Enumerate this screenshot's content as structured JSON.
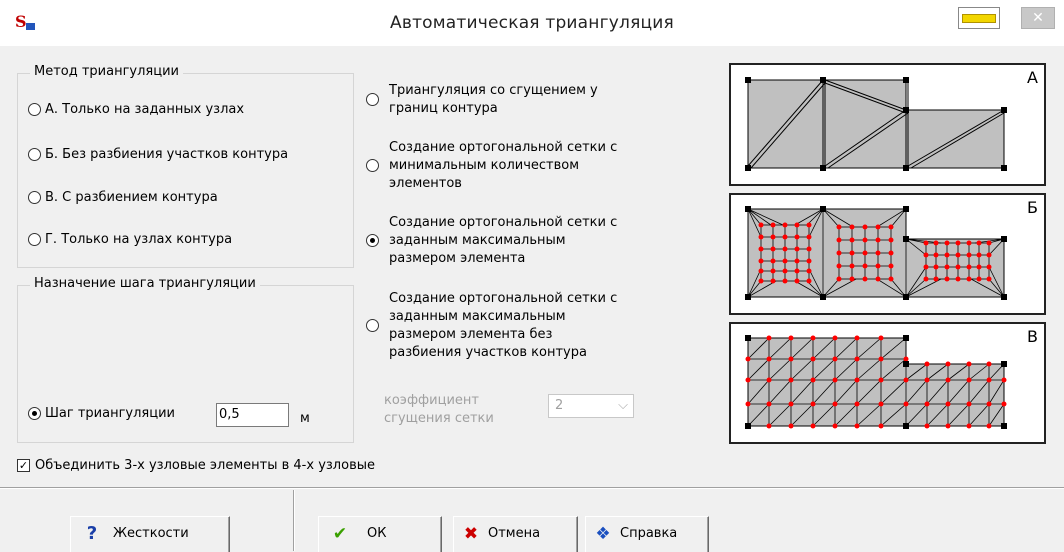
{
  "window": {
    "title": "Автоматическая триангуляция"
  },
  "method_group": {
    "title": "Метод триангуляции",
    "options": [
      {
        "label": "А. Только на заданных узлах",
        "selected": false
      },
      {
        "label": "Б. Без разбиения участков контура",
        "selected": false
      },
      {
        "label": "В. С разбиением контура",
        "selected": false
      },
      {
        "label": "Г. Только на узлах контура",
        "selected": false
      }
    ]
  },
  "sub_options": [
    {
      "label": "Триангуляция со сгущением у\nграниц контура",
      "selected": false
    },
    {
      "label": "Создание ортогональной сетки с\nминимальным количеством\nэлементов",
      "selected": false
    },
    {
      "label": "Создание ортогональной сетки с\nзаданным максимальным\nразмером элемента",
      "selected": true
    },
    {
      "label": "Создание ортогональной сетки с\nзаданным максимальным\nразмером элемента без\nразбиения участков контура",
      "selected": false
    }
  ],
  "step_group": {
    "title": "Назначение шага триангуляции",
    "step_label": "Шаг триангуляции",
    "step_value": "0,5",
    "unit": "м"
  },
  "density": {
    "label": "коэффициент\nсгущения сетки",
    "value": "2",
    "enabled": false
  },
  "merge_checkbox": {
    "label": "Объединить 3-х узловые элементы в 4-х узловые",
    "checked": true
  },
  "buttons": {
    "stiffness": "Жесткости",
    "ok": "ОК",
    "cancel": "Отмена",
    "help": "Справка"
  },
  "previews": [
    {
      "letter": "А"
    },
    {
      "letter": "Б"
    },
    {
      "letter": "В"
    }
  ],
  "colors": {
    "mesh_fill": "#c0c0c0",
    "node_red": "#ff0000",
    "ok_green": "#3aa000",
    "cancel_red": "#cc0000",
    "help_blue": "#1a4fbf"
  }
}
